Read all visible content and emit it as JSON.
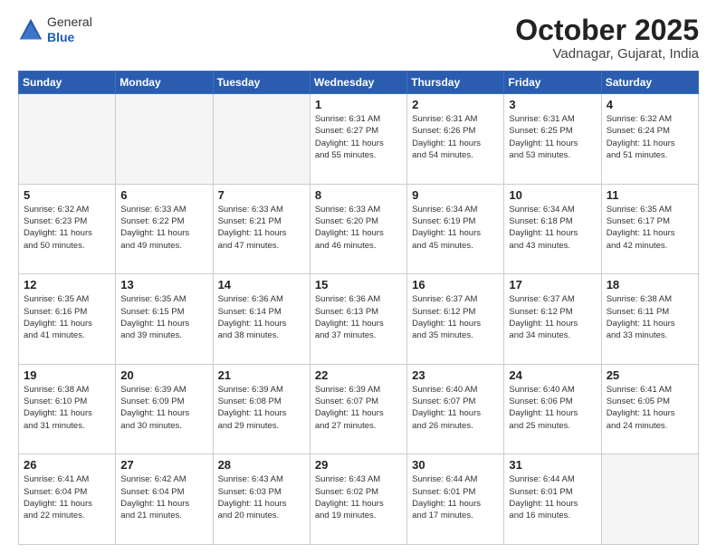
{
  "header": {
    "logo_general": "General",
    "logo_blue": "Blue",
    "month": "October 2025",
    "location": "Vadnagar, Gujarat, India"
  },
  "weekdays": [
    "Sunday",
    "Monday",
    "Tuesday",
    "Wednesday",
    "Thursday",
    "Friday",
    "Saturday"
  ],
  "weeks": [
    [
      {
        "day": "",
        "info": ""
      },
      {
        "day": "",
        "info": ""
      },
      {
        "day": "",
        "info": ""
      },
      {
        "day": "1",
        "info": "Sunrise: 6:31 AM\nSunset: 6:27 PM\nDaylight: 11 hours\nand 55 minutes."
      },
      {
        "day": "2",
        "info": "Sunrise: 6:31 AM\nSunset: 6:26 PM\nDaylight: 11 hours\nand 54 minutes."
      },
      {
        "day": "3",
        "info": "Sunrise: 6:31 AM\nSunset: 6:25 PM\nDaylight: 11 hours\nand 53 minutes."
      },
      {
        "day": "4",
        "info": "Sunrise: 6:32 AM\nSunset: 6:24 PM\nDaylight: 11 hours\nand 51 minutes."
      }
    ],
    [
      {
        "day": "5",
        "info": "Sunrise: 6:32 AM\nSunset: 6:23 PM\nDaylight: 11 hours\nand 50 minutes."
      },
      {
        "day": "6",
        "info": "Sunrise: 6:33 AM\nSunset: 6:22 PM\nDaylight: 11 hours\nand 49 minutes."
      },
      {
        "day": "7",
        "info": "Sunrise: 6:33 AM\nSunset: 6:21 PM\nDaylight: 11 hours\nand 47 minutes."
      },
      {
        "day": "8",
        "info": "Sunrise: 6:33 AM\nSunset: 6:20 PM\nDaylight: 11 hours\nand 46 minutes."
      },
      {
        "day": "9",
        "info": "Sunrise: 6:34 AM\nSunset: 6:19 PM\nDaylight: 11 hours\nand 45 minutes."
      },
      {
        "day": "10",
        "info": "Sunrise: 6:34 AM\nSunset: 6:18 PM\nDaylight: 11 hours\nand 43 minutes."
      },
      {
        "day": "11",
        "info": "Sunrise: 6:35 AM\nSunset: 6:17 PM\nDaylight: 11 hours\nand 42 minutes."
      }
    ],
    [
      {
        "day": "12",
        "info": "Sunrise: 6:35 AM\nSunset: 6:16 PM\nDaylight: 11 hours\nand 41 minutes."
      },
      {
        "day": "13",
        "info": "Sunrise: 6:35 AM\nSunset: 6:15 PM\nDaylight: 11 hours\nand 39 minutes."
      },
      {
        "day": "14",
        "info": "Sunrise: 6:36 AM\nSunset: 6:14 PM\nDaylight: 11 hours\nand 38 minutes."
      },
      {
        "day": "15",
        "info": "Sunrise: 6:36 AM\nSunset: 6:13 PM\nDaylight: 11 hours\nand 37 minutes."
      },
      {
        "day": "16",
        "info": "Sunrise: 6:37 AM\nSunset: 6:12 PM\nDaylight: 11 hours\nand 35 minutes."
      },
      {
        "day": "17",
        "info": "Sunrise: 6:37 AM\nSunset: 6:12 PM\nDaylight: 11 hours\nand 34 minutes."
      },
      {
        "day": "18",
        "info": "Sunrise: 6:38 AM\nSunset: 6:11 PM\nDaylight: 11 hours\nand 33 minutes."
      }
    ],
    [
      {
        "day": "19",
        "info": "Sunrise: 6:38 AM\nSunset: 6:10 PM\nDaylight: 11 hours\nand 31 minutes."
      },
      {
        "day": "20",
        "info": "Sunrise: 6:39 AM\nSunset: 6:09 PM\nDaylight: 11 hours\nand 30 minutes."
      },
      {
        "day": "21",
        "info": "Sunrise: 6:39 AM\nSunset: 6:08 PM\nDaylight: 11 hours\nand 29 minutes."
      },
      {
        "day": "22",
        "info": "Sunrise: 6:39 AM\nSunset: 6:07 PM\nDaylight: 11 hours\nand 27 minutes."
      },
      {
        "day": "23",
        "info": "Sunrise: 6:40 AM\nSunset: 6:07 PM\nDaylight: 11 hours\nand 26 minutes."
      },
      {
        "day": "24",
        "info": "Sunrise: 6:40 AM\nSunset: 6:06 PM\nDaylight: 11 hours\nand 25 minutes."
      },
      {
        "day": "25",
        "info": "Sunrise: 6:41 AM\nSunset: 6:05 PM\nDaylight: 11 hours\nand 24 minutes."
      }
    ],
    [
      {
        "day": "26",
        "info": "Sunrise: 6:41 AM\nSunset: 6:04 PM\nDaylight: 11 hours\nand 22 minutes."
      },
      {
        "day": "27",
        "info": "Sunrise: 6:42 AM\nSunset: 6:04 PM\nDaylight: 11 hours\nand 21 minutes."
      },
      {
        "day": "28",
        "info": "Sunrise: 6:43 AM\nSunset: 6:03 PM\nDaylight: 11 hours\nand 20 minutes."
      },
      {
        "day": "29",
        "info": "Sunrise: 6:43 AM\nSunset: 6:02 PM\nDaylight: 11 hours\nand 19 minutes."
      },
      {
        "day": "30",
        "info": "Sunrise: 6:44 AM\nSunset: 6:01 PM\nDaylight: 11 hours\nand 17 minutes."
      },
      {
        "day": "31",
        "info": "Sunrise: 6:44 AM\nSunset: 6:01 PM\nDaylight: 11 hours\nand 16 minutes."
      },
      {
        "day": "",
        "info": ""
      }
    ]
  ]
}
